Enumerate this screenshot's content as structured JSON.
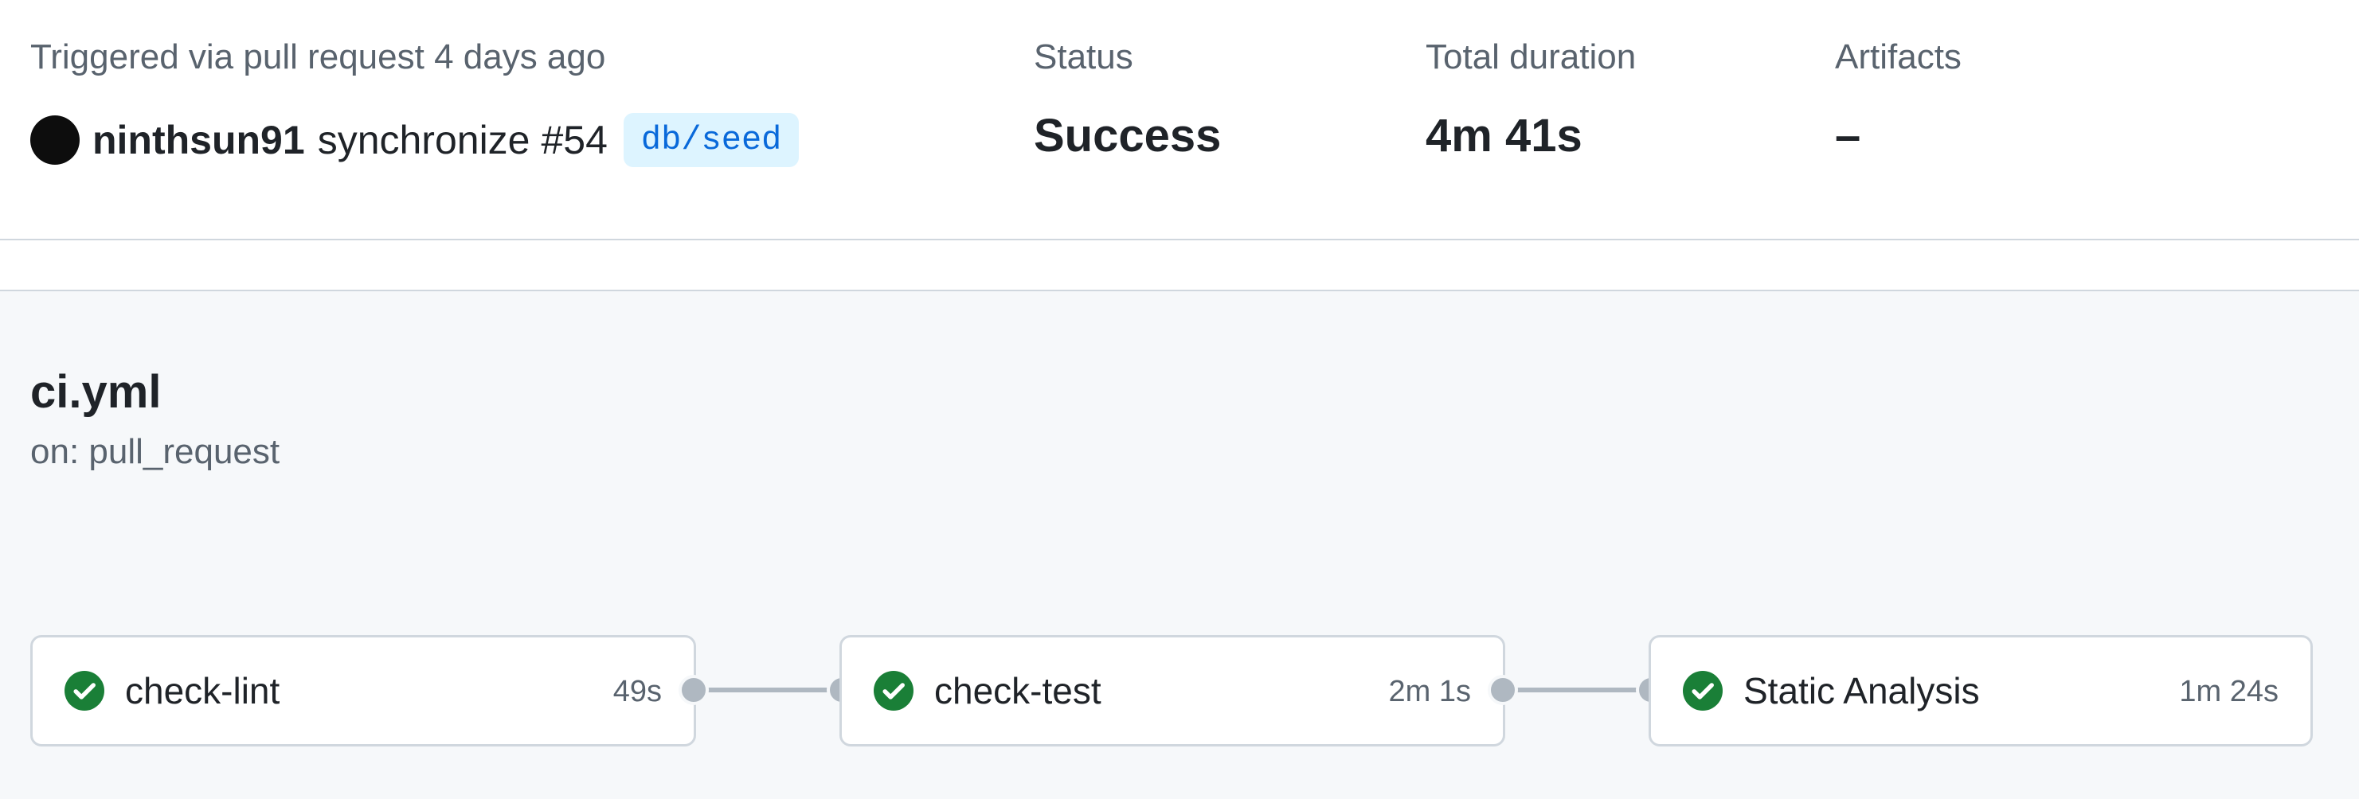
{
  "summary": {
    "trigger_label": "Triggered via pull request 4 days ago",
    "actor": "ninthsun91",
    "event": "synchronize",
    "pr_number": "#54",
    "branch": "db/seed",
    "status_label": "Status",
    "status_value": "Success",
    "duration_label": "Total duration",
    "duration_value": "4m 41s",
    "artifacts_label": "Artifacts",
    "artifacts_value": "–"
  },
  "workflow": {
    "file": "ci.yml",
    "trigger": "on: pull_request",
    "jobs": [
      {
        "name": "check-lint",
        "duration": "49s",
        "status": "success",
        "icon": "check-circle-icon"
      },
      {
        "name": "check-test",
        "duration": "2m 1s",
        "status": "success",
        "icon": "check-circle-icon"
      },
      {
        "name": "Static Analysis",
        "duration": "1m 24s",
        "status": "success",
        "icon": "check-circle-icon"
      }
    ]
  },
  "colors": {
    "success": "#1a7f37",
    "branch_text": "#0969da",
    "branch_bg": "#ddf4ff",
    "connector": "#afb8c1"
  }
}
